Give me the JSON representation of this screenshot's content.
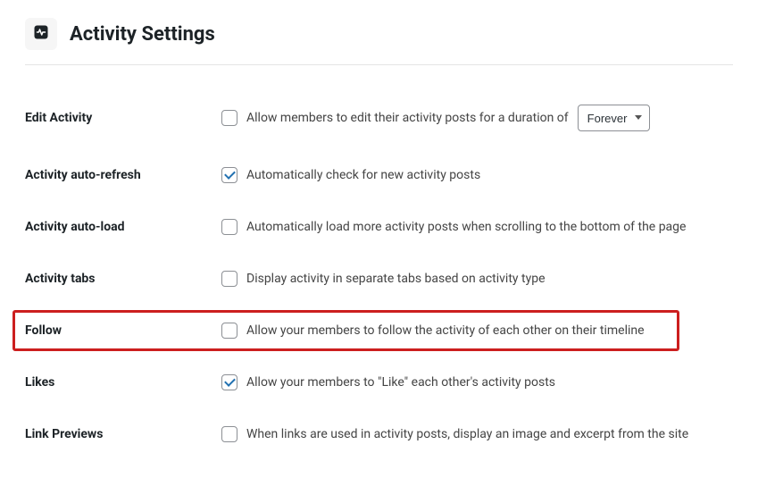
{
  "header": {
    "title": "Activity Settings"
  },
  "settings": {
    "edit_activity": {
      "label": "Edit Activity",
      "desc_prefix": "Allow members to edit their activity posts for a duration of",
      "checked": false,
      "duration_selected": "Forever"
    },
    "auto_refresh": {
      "label": "Activity auto-refresh",
      "desc": "Automatically check for new activity posts",
      "checked": true
    },
    "auto_load": {
      "label": "Activity auto-load",
      "desc": "Automatically load more activity posts when scrolling to the bottom of the page",
      "checked": false
    },
    "tabs": {
      "label": "Activity tabs",
      "desc": "Display activity in separate tabs based on activity type",
      "checked": false
    },
    "follow": {
      "label": "Follow",
      "desc": "Allow your members to follow the activity of each other on their timeline",
      "checked": false
    },
    "likes": {
      "label": "Likes",
      "desc": "Allow your members to \"Like\" each other's activity posts",
      "checked": true
    },
    "link_previews": {
      "label": "Link Previews",
      "desc": "When links are used in activity posts, display an image and excerpt from the site",
      "checked": false
    }
  }
}
